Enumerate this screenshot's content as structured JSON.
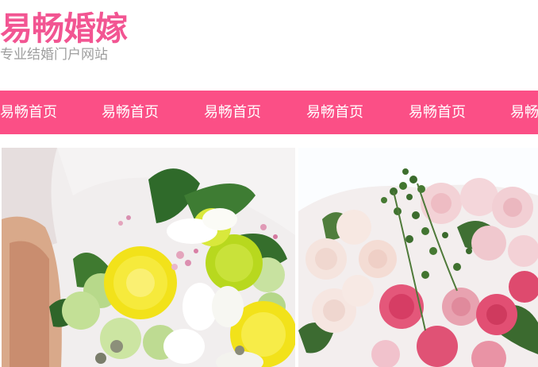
{
  "site": {
    "title": "易畅婚嫁",
    "subtitle": "专业结婚门户网站"
  },
  "nav": {
    "items": [
      {
        "label": "易畅首页"
      },
      {
        "label": "易畅首页"
      },
      {
        "label": "易畅首页"
      },
      {
        "label": "易畅首页"
      },
      {
        "label": "易畅首页"
      },
      {
        "label": "易畅首页"
      }
    ]
  },
  "colors": {
    "brand_pink": "#f25592",
    "nav_background": "#fb4f86",
    "subtitle_gray": "#9e9e9e"
  },
  "gallery": {
    "photos": [
      {
        "subject": "yellow-green-bouquet"
      },
      {
        "subject": "pink-rose-bouquet"
      }
    ]
  }
}
